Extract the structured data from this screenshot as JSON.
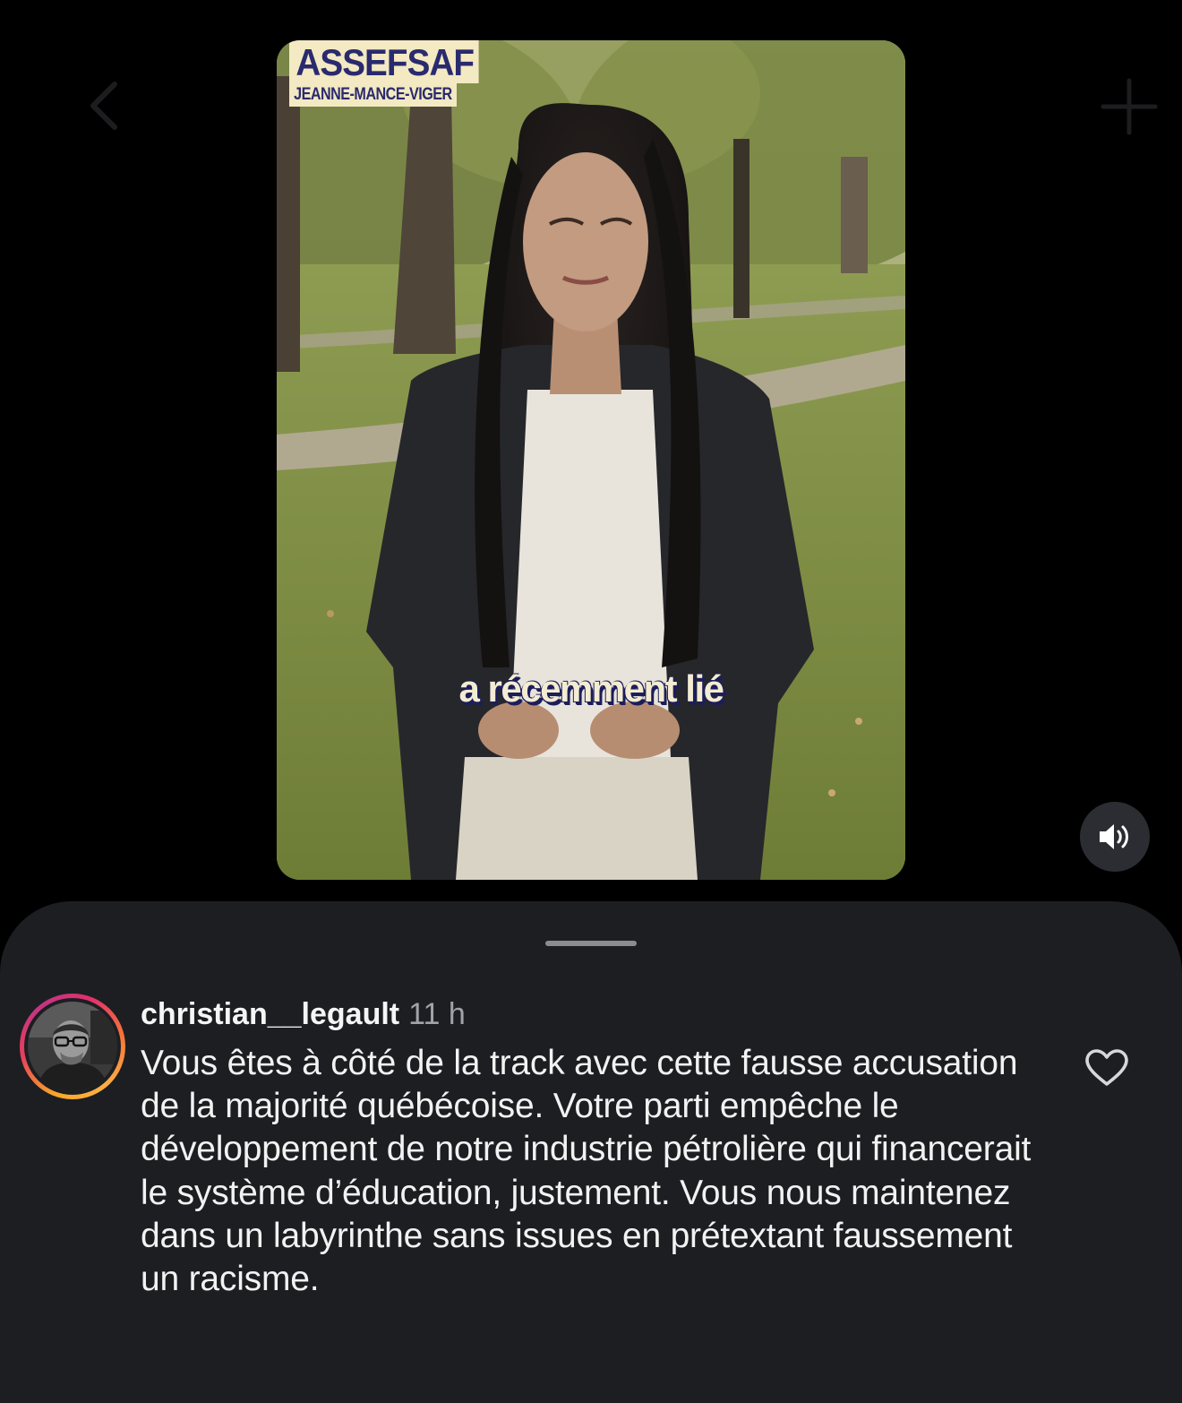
{
  "nav": {
    "back_icon": "chevron-left-icon",
    "add_icon": "plus-icon"
  },
  "video": {
    "brand_name": "ASSEFSAF",
    "brand_subtitle": "JEANNE-MANCE-VIGER",
    "caption": "a récemment lié",
    "mute_icon": "speaker-on-icon"
  },
  "comment": {
    "username": "christian__legault",
    "time": "11 h",
    "text": "Vous êtes à côté de la track avec cette fausse accusation de la majorité québécoise. Votre parti empêche le développement de notre industrie pétrolière qui financerait le système d’éducation, justement. Vous nous maintenez dans un labyrinthe sans issues en prétextant faussement un racisme.",
    "like_icon": "heart-outline-icon"
  },
  "colors": {
    "background": "#000000",
    "sheet": "#1c1e22",
    "brand_bg": "#f3e9c2",
    "brand_text": "#2a2a6e",
    "secondary_text": "#a0a3a8"
  }
}
